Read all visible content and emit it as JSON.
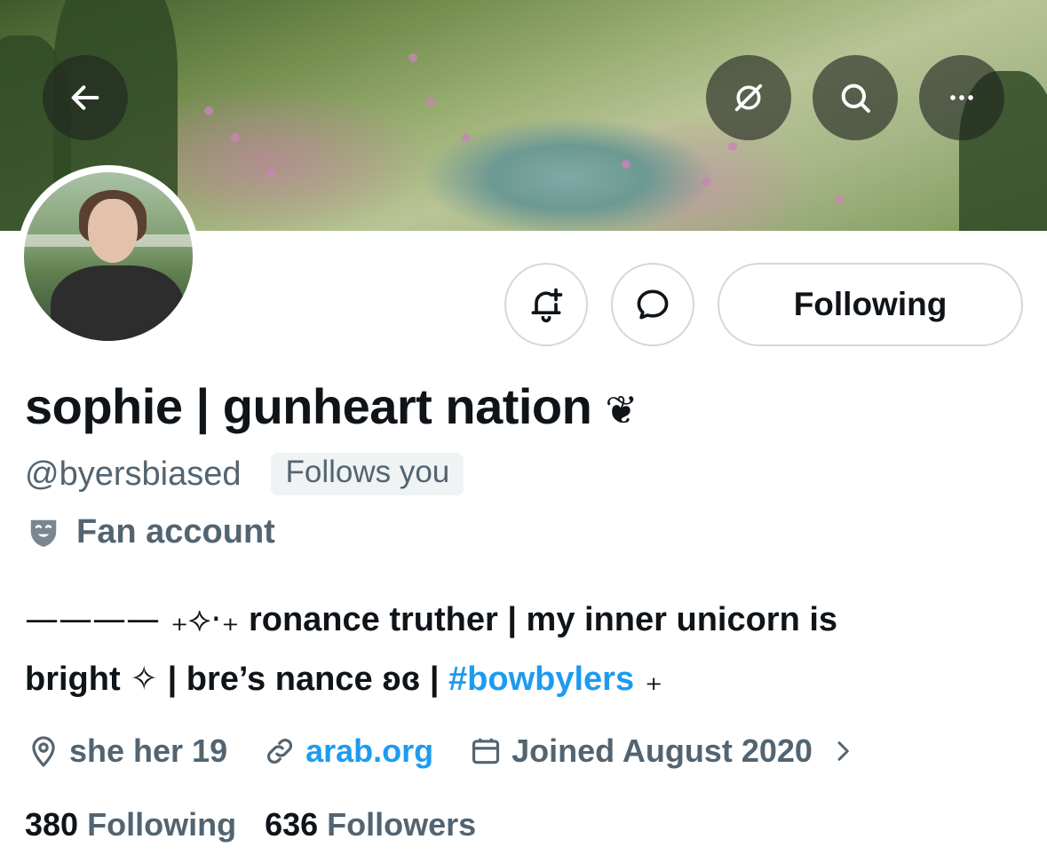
{
  "profile": {
    "display_name": "sophie | gunheart nation",
    "name_emoji": "❦",
    "handle": "@byersbiased",
    "follows_you": "Follows you",
    "category": "Fan account",
    "bio": {
      "line1_deco": "———— ₊⟡⋅₊",
      "line1_text": " ronance truther | my inner unicorn is",
      "line2_text": "bright ✧ | bre’s nance ʚɞ | ",
      "hashtag": "#bowbylers",
      "line2_tail": " ₊"
    },
    "location": "she her 19",
    "website": "arab.org",
    "joined": "Joined August 2020",
    "following_count": "380",
    "following_label": "Following",
    "followers_count": "636",
    "followers_label": "Followers"
  },
  "actions": {
    "follow_state_label": "Following",
    "notify_icon": "bell-plus-icon",
    "message_icon": "chat-bubble-icon"
  },
  "header_icons": [
    "back-arrow-icon",
    "grok-icon",
    "search-icon",
    "more-icon"
  ],
  "colors": {
    "accent": "#1d9bf0",
    "secondary_text": "#536471",
    "primary_text": "#0f1419",
    "border": "#cfd9de"
  }
}
